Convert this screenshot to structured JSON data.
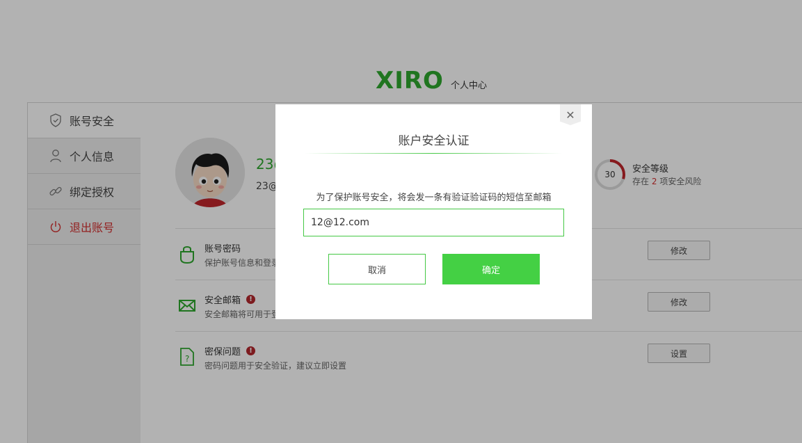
{
  "header": {
    "logo": "XIRO",
    "subtitle": "个人中心"
  },
  "sidebar": {
    "items": [
      {
        "label": "账号安全",
        "icon": "shield-icon"
      },
      {
        "label": "个人信息",
        "icon": "user-icon"
      },
      {
        "label": "绑定授权",
        "icon": "link-icon"
      },
      {
        "label": "退出账号",
        "icon": "power-icon"
      }
    ]
  },
  "profile": {
    "name": "23@",
    "sub": "23@"
  },
  "security": {
    "score": "30",
    "score_fraction": 0.3,
    "level_title": "安全等级",
    "risk_prefix": "存在",
    "risk_count": "2",
    "risk_suffix": "项安全风险"
  },
  "rows": [
    {
      "title": "账号密码",
      "desc": "保护账号信息和登录",
      "button": "修改",
      "warning": false
    },
    {
      "title": "安全邮箱",
      "desc": "安全邮箱将可用于登",
      "button": "修改",
      "warning": true
    },
    {
      "title": "密保问题",
      "desc": "密码问题用于安全验证，建议立即设置",
      "button": "设置",
      "warning": true
    }
  ],
  "modal": {
    "title": "账户安全认证",
    "message": "为了保护账号安全，将会发一条有验证验证码的短信至邮箱",
    "email_value": "12@12.com",
    "cancel_label": "取消",
    "confirm_label": "确定",
    "close_symbol": "✕"
  },
  "colors": {
    "brand_green": "#2ea82e",
    "button_green": "#44d044",
    "warning_red": "#b3282d",
    "logout_red": "#d32f2f"
  }
}
